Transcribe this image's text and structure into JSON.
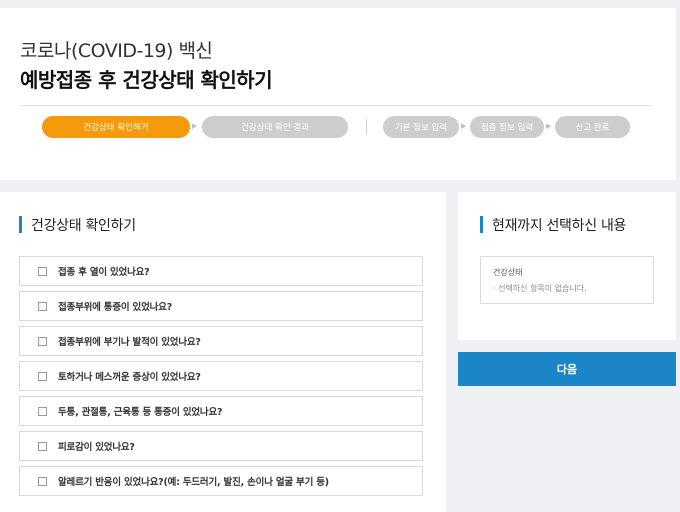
{
  "header": {
    "title_line1": "코로나(COVID-19) 백신",
    "title_line2": "예방접종 후 건강상태 확인하기"
  },
  "steps": [
    {
      "label": "건강상태 확인하기",
      "active": true
    },
    {
      "label": "건강상태 확인 결과",
      "active": false
    },
    {
      "label": "기본 정보 입력",
      "active": false
    },
    {
      "label": "접종 정보 입력",
      "active": false
    },
    {
      "label": "신고 완료",
      "active": false
    }
  ],
  "health_check": {
    "title": "건강상태 확인하기",
    "questions": [
      "접종 후 열이 있었나요?",
      "접종부위에 통증이 있었나요?",
      "접종부위에 부기나 발적이 있었나요?",
      "토하거나 메스꺼운 증상이 있었나요?",
      "두통, 관절통, 근육통 등 통증이 있었나요?",
      "피로감이 있었나요?",
      "알레르기 반응이 있었나요?(예: 두드러기, 발진, 손이나 얼굴 부기 등)"
    ]
  },
  "selection": {
    "title": "현재까지 선택하신 내용",
    "heading": "건강상태",
    "empty_text": "· 선택하신 항목이 없습니다."
  },
  "actions": {
    "next_label": "다음"
  },
  "colors": {
    "accent_blue": "#1a86c8",
    "active_step": "#f59a0d",
    "inactive_step": "#cdcdcd"
  }
}
